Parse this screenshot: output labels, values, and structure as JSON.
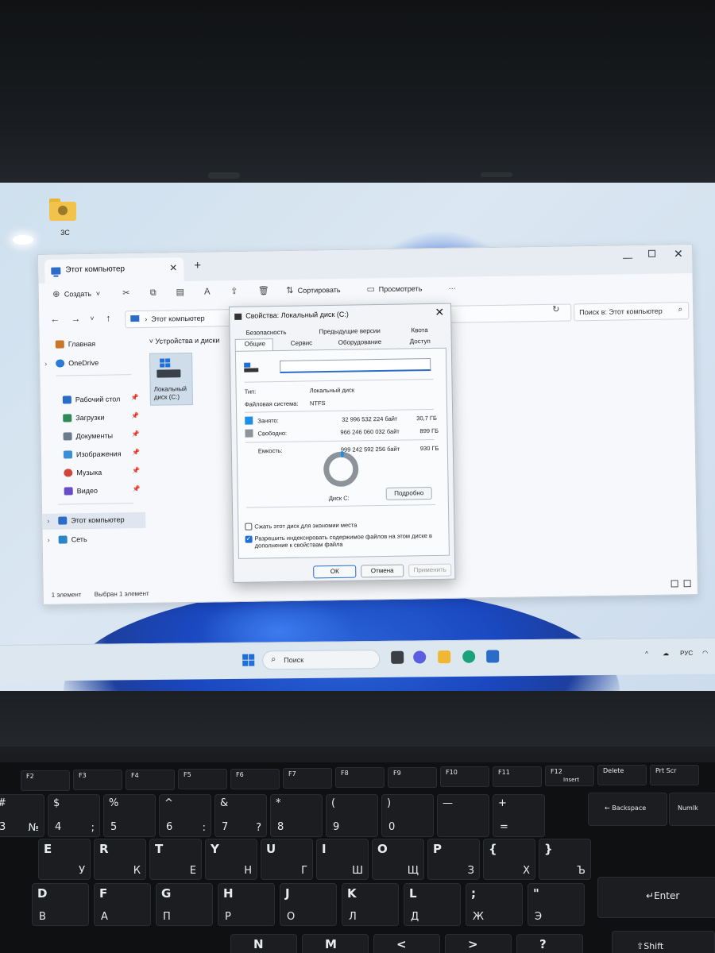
{
  "desktop": {
    "icon_label": "3C"
  },
  "explorer": {
    "tab_title": "Этот компьютер",
    "toolbar": {
      "create": "Создать",
      "sort": "Сортировать",
      "view": "Просмотреть",
      "more": "···"
    },
    "address": "Этот компьютер",
    "search_placeholder": "Поиск в: Этот компьютер",
    "sidebar": [
      {
        "label": "Главная",
        "icon": "home-icon"
      },
      {
        "label": "OneDrive",
        "icon": "cloud-icon"
      },
      {
        "label": "Рабочий стол",
        "icon": "desktop-icon"
      },
      {
        "label": "Загрузки",
        "icon": "download-icon"
      },
      {
        "label": "Документы",
        "icon": "documents-icon"
      },
      {
        "label": "Изображения",
        "icon": "pictures-icon"
      },
      {
        "label": "Музыка",
        "icon": "music-icon"
      },
      {
        "label": "Видео",
        "icon": "video-icon"
      },
      {
        "label": "Этот компьютер",
        "icon": "computer-icon"
      },
      {
        "label": "Сеть",
        "icon": "network-icon"
      }
    ],
    "group_header": "Устройства и диски",
    "drive_label": "Локальный диск (C:)",
    "status_count": "1 элемент",
    "status_selected": "Выбран 1 элемент"
  },
  "dialog": {
    "title": "Свойства: Локальный диск (C:)",
    "tabs_top": [
      "Безопасность",
      "Предыдущие версии",
      "Квота"
    ],
    "tabs_bottom": [
      "Общие",
      "Сервис",
      "Оборудование",
      "Доступ"
    ],
    "type_label": "Тип:",
    "type_value": "Локальный диск",
    "fs_label": "Файловая система:",
    "fs_value": "NTFS",
    "used_label": "Занято:",
    "used_bytes": "32 996 532 224 байт",
    "used_gb": "30,7 ГБ",
    "free_label": "Свободно:",
    "free_bytes": "966 246 060 032 байт",
    "free_gb": "899 ГБ",
    "capacity_label": "Емкость:",
    "capacity_bytes": "999 242 592 256 байт",
    "capacity_gb": "930 ГБ",
    "used_fraction": 0.033,
    "disk_label": "Диск C:",
    "details_button": "Подробно",
    "compress_label": "Сжать этот диск для экономии места",
    "index_label": "Разрешить индексировать содержимое файлов на этом диске в дополнение к свойствам файла",
    "ok": "ОК",
    "cancel": "Отмена",
    "apply": "Применить",
    "colors": {
      "used": "#1f8fe6",
      "free": "#8d939a"
    }
  },
  "taskbar": {
    "search": "Поиск",
    "lang": "РУС"
  },
  "keyboard": {
    "fkeys": [
      "F2",
      "F3",
      "F4",
      "F5",
      "F6",
      "F7",
      "F8",
      "F9",
      "F10",
      "F11",
      "F12",
      "Delete",
      "Prt Scr"
    ],
    "fkey_extra": {
      "F12": "Insert"
    },
    "row_num": [
      {
        "top": "#",
        "bot": "3",
        "alt": "№"
      },
      {
        "top": "$",
        "bot": "4",
        "alt": ";"
      },
      {
        "top": "%",
        "bot": "5",
        "alt": ""
      },
      {
        "top": "^",
        "bot": "6",
        "alt": ":"
      },
      {
        "top": "&",
        "bot": "7",
        "alt": "?"
      },
      {
        "top": "*",
        "bot": "8",
        "alt": ""
      },
      {
        "top": "(",
        "bot": "9",
        "alt": ""
      },
      {
        "top": ")",
        "bot": "0",
        "alt": ""
      },
      {
        "top": "—",
        "bot": "",
        "alt": ""
      },
      {
        "top": "+",
        "bot": "=",
        "alt": ""
      }
    ],
    "backspace": "Backspace",
    "numlk": "Numlk",
    "row_q": [
      {
        "top": "E",
        "bot": "У"
      },
      {
        "top": "R",
        "bot": "К"
      },
      {
        "top": "T",
        "bot": "Е"
      },
      {
        "top": "Y",
        "bot": "Н"
      },
      {
        "top": "U",
        "bot": "Г"
      },
      {
        "top": "I",
        "bot": "Ш"
      },
      {
        "top": "O",
        "bot": "Щ"
      },
      {
        "top": "P",
        "bot": "З"
      },
      {
        "top": "{",
        "bot": "Х"
      },
      {
        "top": "}",
        "bot": "Ъ"
      }
    ],
    "row_a": [
      {
        "top": "D",
        "bot": "В"
      },
      {
        "top": "F",
        "bot": "А"
      },
      {
        "top": "G",
        "bot": "П"
      },
      {
        "top": "H",
        "bot": "Р"
      },
      {
        "top": "J",
        "bot": "О"
      },
      {
        "top": "K",
        "bot": "Л"
      },
      {
        "top": "L",
        "bot": "Д"
      },
      {
        "top": ";",
        "bot": "Ж"
      },
      {
        "top": "\"",
        "bot": "Э"
      }
    ],
    "enter": "Enter",
    "shift": "Shift",
    "row_z_partial": [
      {
        "top": "N",
        "bot": ""
      },
      {
        "top": "M",
        "bot": ""
      },
      {
        "top": "<",
        "bot": ""
      },
      {
        "top": ">",
        "bot": ""
      },
      {
        "top": "?",
        "bot": ""
      }
    ]
  }
}
